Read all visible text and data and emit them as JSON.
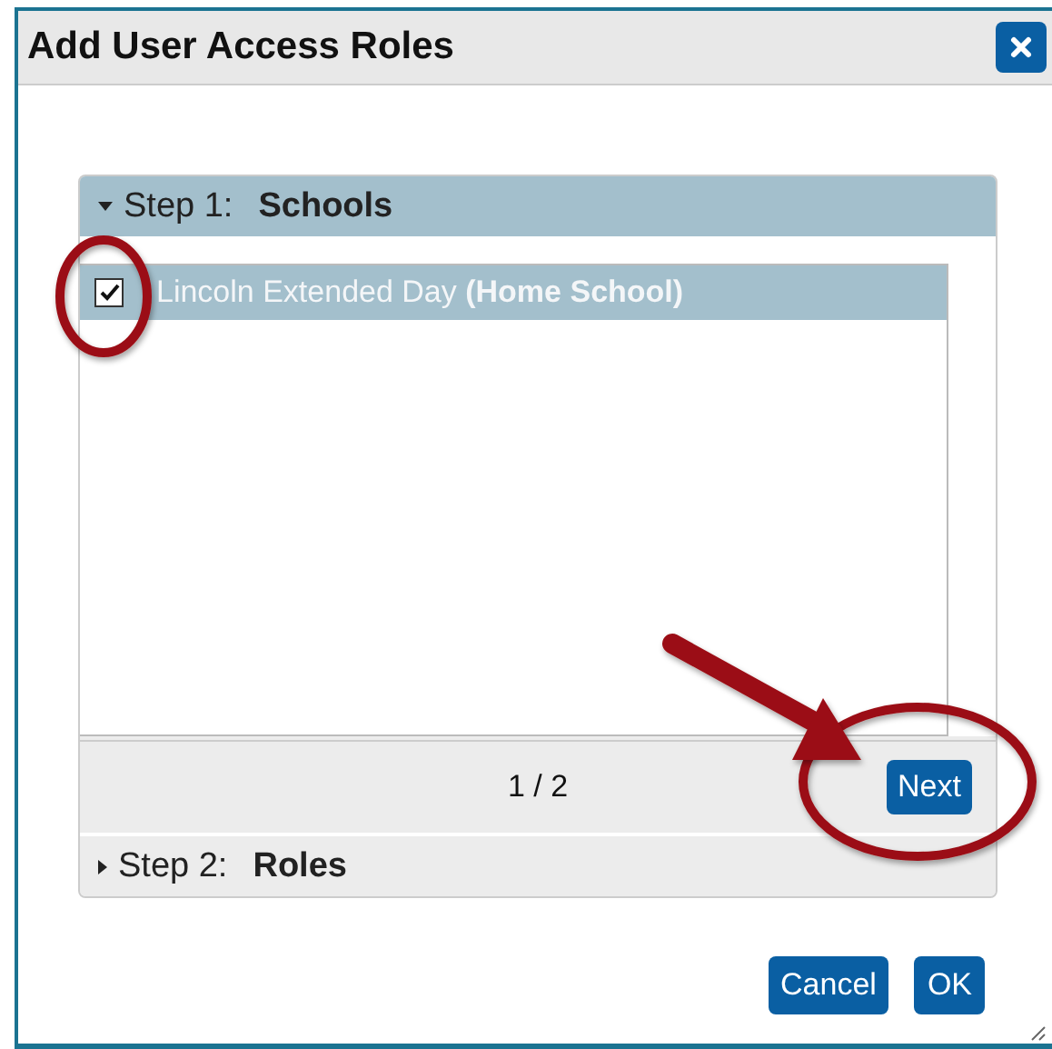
{
  "dialog": {
    "title": "Add User Access Roles"
  },
  "steps": [
    {
      "label": "Step 1:",
      "name": "Schools",
      "expanded": true,
      "items": [
        {
          "label": "Lincoln Extended Day **(Home School)**",
          "checked": true,
          "selected": true
        }
      ],
      "pager": "1 / 2",
      "next": "Next"
    },
    {
      "label": "Step 2:",
      "name": "Roles",
      "expanded": false
    }
  ],
  "buttons": [
    "Cancel",
    "OK"
  ]
}
